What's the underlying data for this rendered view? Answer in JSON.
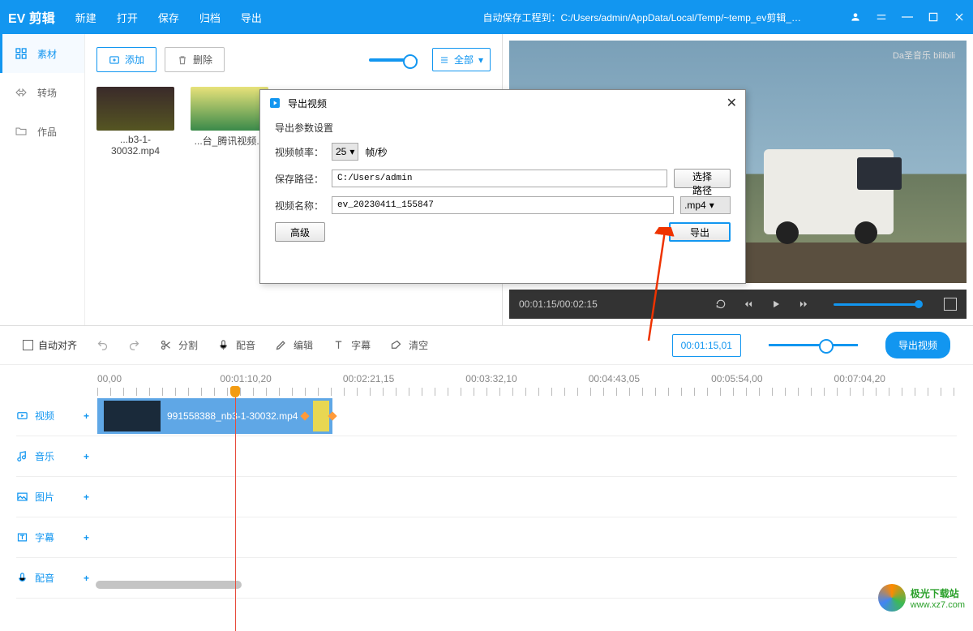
{
  "app": {
    "title": "EV 剪辑"
  },
  "menu": {
    "new": "新建",
    "open": "打开",
    "save": "保存",
    "archive": "归档",
    "export": "导出"
  },
  "autosave": "自动保存工程到：C:/Users/admin/AppData/Local/Temp/~temp_ev剪辑_…",
  "sidetabs": {
    "media": "素材",
    "transition": "转场",
    "works": "作品"
  },
  "mediabar": {
    "add": "添加",
    "delete": "删除",
    "all": "全部"
  },
  "thumbs": [
    {
      "name": "...b3-1-30032.mp4"
    },
    {
      "name": "...台_腾讯视频..."
    }
  ],
  "preview": {
    "watermark": "Da圣音乐   bilibili",
    "time": "00:01:15/00:02:15"
  },
  "dialog": {
    "title": "导出视频",
    "section": "导出参数设置",
    "fps_label": "视频帧率：",
    "fps_value": "25",
    "fps_unit": "帧/秒",
    "path_label": "保存路径：",
    "path_value": "C:/Users/admin",
    "choose": "选择路径",
    "name_label": "视频名称：",
    "name_value": "ev_20230411_155847",
    "ext": ".mp4",
    "advanced": "高级",
    "export": "导出"
  },
  "toolbar": {
    "align": "自动对齐",
    "split": "分割",
    "dub": "配音",
    "edit": "编辑",
    "subtitle": "字幕",
    "clear": "清空",
    "timecode": "00:01:15,01",
    "export": "导出视频"
  },
  "ruler": [
    "00,00",
    "00:01:10,20",
    "00:02:21,15",
    "00:03:32,10",
    "00:04:43,05",
    "00:05:54,00",
    "00:07:04,20"
  ],
  "tracks": {
    "video": "视频",
    "audio": "音乐",
    "image": "图片",
    "subtitle": "字幕",
    "voice": "配音"
  },
  "clip": {
    "name": "991558388_nb3-1-30032.mp4"
  },
  "site": {
    "text": "极光下载站",
    "url": "www.xz7.com"
  }
}
